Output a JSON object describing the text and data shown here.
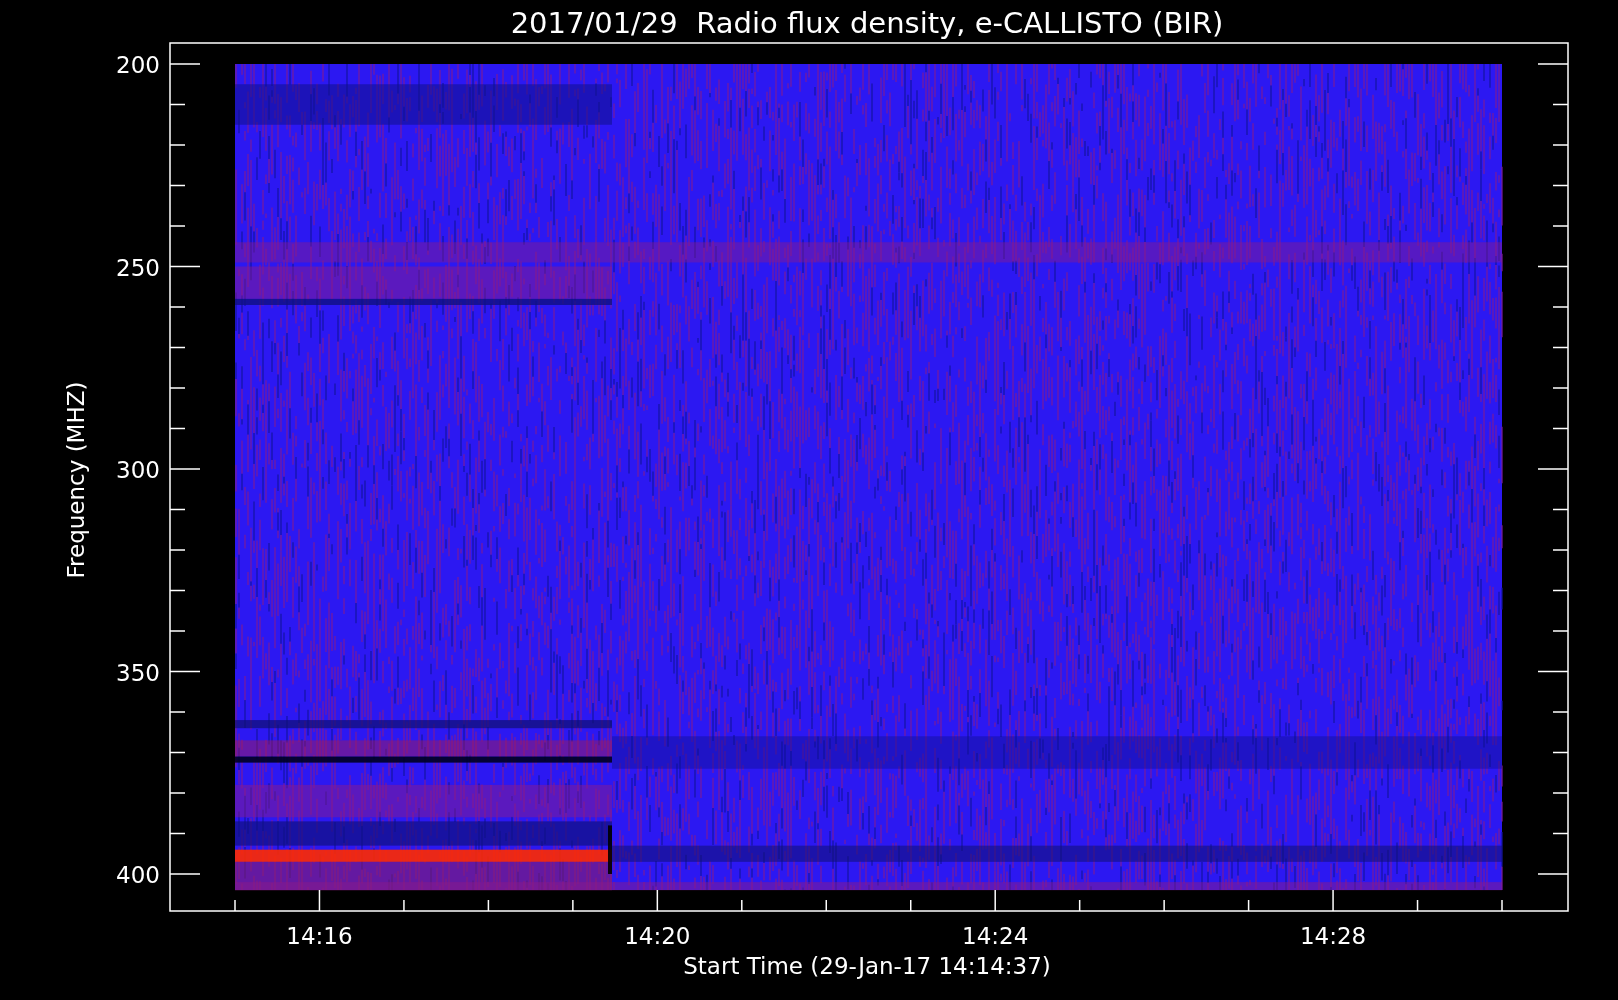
{
  "title": "2017/01/29  Radio flux density, e-CALLISTO (BIR)",
  "y_axis": {
    "label": "Frequency (MHZ)",
    "ticks": [
      "200",
      "250",
      "300",
      "350",
      "400"
    ]
  },
  "x_axis": {
    "label": "Start Time (29-Jan-17 14:14:37)",
    "ticks": [
      "14:16",
      "14:20",
      "14:24",
      "14:28"
    ]
  }
}
